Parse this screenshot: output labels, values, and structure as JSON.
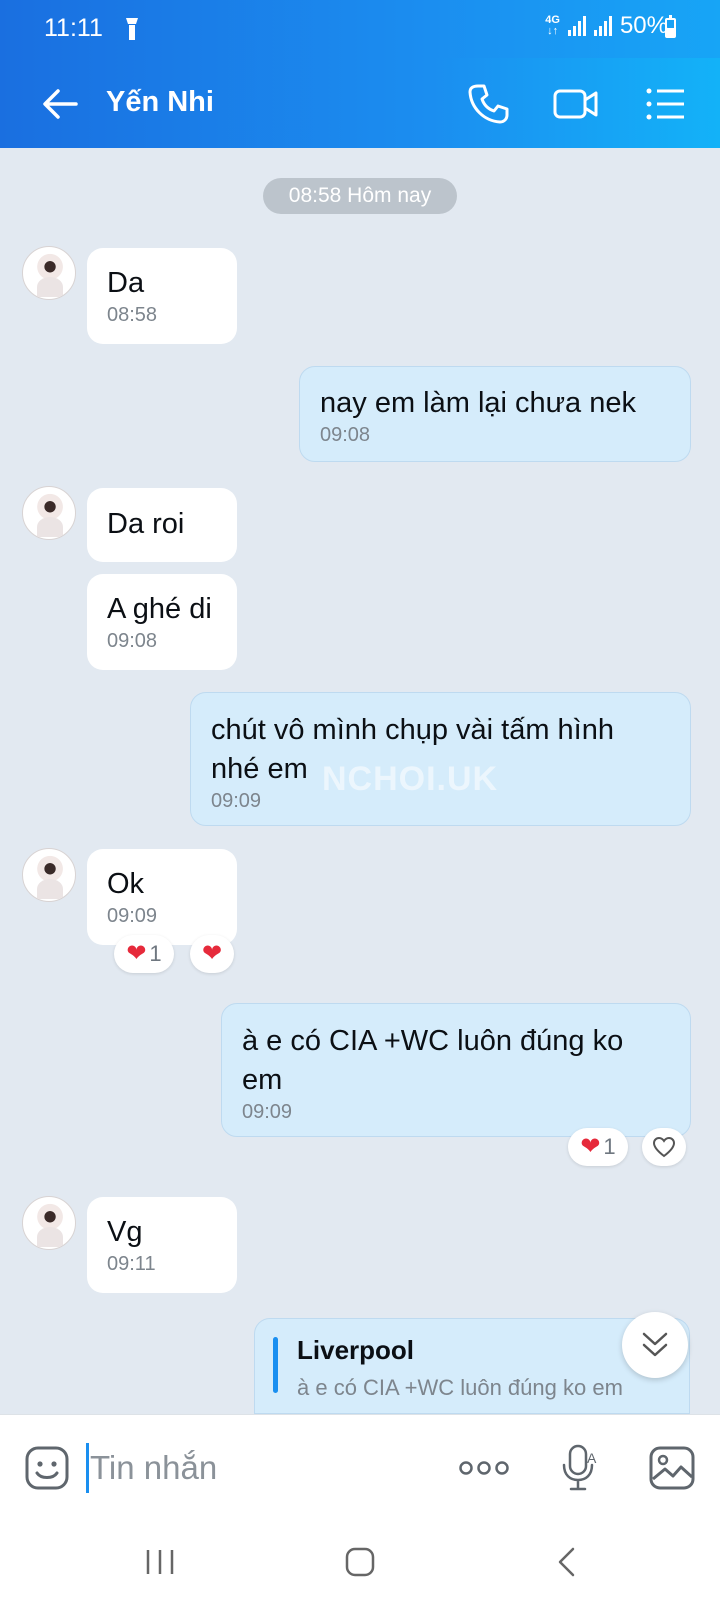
{
  "status_bar": {
    "time": "11:11",
    "network": "4G",
    "battery": "50%"
  },
  "header": {
    "contact_name": "Yến Nhi",
    "icons": [
      "back-arrow-icon",
      "phone-icon",
      "video-call-icon",
      "list-menu-icon"
    ]
  },
  "conversation": {
    "date_label": "08:58 Hôm nay",
    "messages": [
      {
        "side": "in",
        "text": "Da",
        "time": "08:58"
      },
      {
        "side": "out",
        "text": "nay em làm lại chưa nek",
        "time": "09:08"
      },
      {
        "side": "in",
        "text": "Da roi"
      },
      {
        "side": "in",
        "text": "A ghé di",
        "time": "09:08"
      },
      {
        "side": "out",
        "text_lines": [
          "chút vô mình chụp vài tấm hình",
          "nhé em"
        ],
        "time": "09:09"
      },
      {
        "side": "in",
        "text": "Ok",
        "time": "09:09",
        "reaction_count": "1"
      },
      {
        "side": "out",
        "text_lines": [
          "à e có CIA +WC luôn đúng ko",
          "em"
        ],
        "time": "09:09",
        "reaction_count": "1"
      },
      {
        "side": "in",
        "text": "Vg",
        "time": "09:11"
      }
    ],
    "reply_preview": {
      "name": "Liverpool",
      "quote": "à e có CIA +WC luôn đúng ko em"
    },
    "watermark": "NCHOI.UK"
  },
  "composer": {
    "placeholder": "Tin nhắn"
  },
  "colors": {
    "header_start": "#1a6fe0",
    "header_end": "#13b2f8",
    "outgoing_bubble": "#d5ecfb",
    "incoming_bubble": "#ffffff",
    "background": "#e2e9f1",
    "heart": "#e62a3b"
  }
}
